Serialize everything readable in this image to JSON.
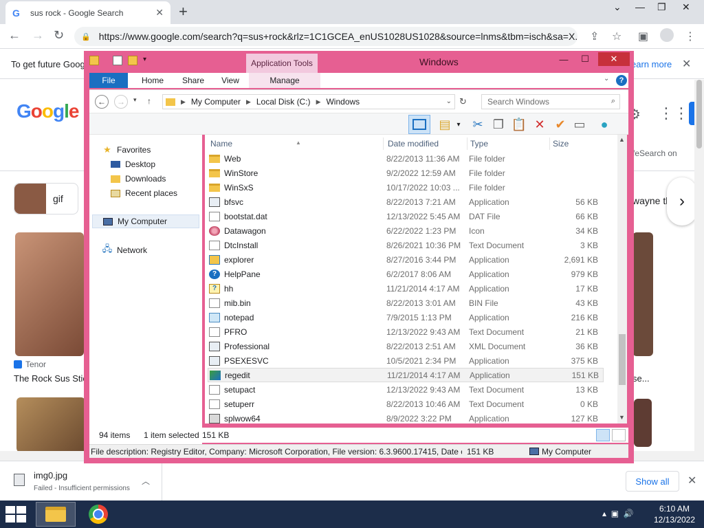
{
  "browser": {
    "tab_title": "sus rock - Google Search",
    "url": "https://www.google.com/search?q=sus+rock&rlz=1C1GCEA_enUS1028US1028&source=lnms&tbm=isch&sa=X...",
    "infobar_text": "To get future Goog",
    "infobar_link": "earn more"
  },
  "google": {
    "logo_letters": [
      "G",
      "o",
      "o",
      "g",
      "l",
      "e"
    ],
    "chip_label": "gif",
    "source_name": "Tenor",
    "result_title": "The Rock Sus Stick",
    "right_text_safesearch": "feSearch on",
    "right_text_chip": "wayne th",
    "right_text_result": "se..."
  },
  "downloads": {
    "file_name": "img0.jpg",
    "status": "Failed - Insufficient permissions",
    "show_all": "Show all"
  },
  "taskbar": {
    "time": "6:10 AM",
    "date": "12/13/2022"
  },
  "explorer": {
    "title": "Windows",
    "app_tools": "Application Tools",
    "tabs": {
      "file": "File",
      "home": "Home",
      "share": "Share",
      "view": "View",
      "manage": "Manage"
    },
    "breadcrumb": [
      "My Computer",
      "Local Disk (C:)",
      "Windows"
    ],
    "search_placeholder": "Search Windows",
    "nav": {
      "favorites": "Favorites",
      "desktop": "Desktop",
      "downloads": "Downloads",
      "recent": "Recent places",
      "my_computer": "My Computer",
      "network": "Network"
    },
    "columns": {
      "name": "Name",
      "date": "Date modified",
      "type": "Type",
      "size": "Size"
    },
    "files": [
      {
        "name": "Web",
        "date": "8/22/2013 11:36 AM",
        "type": "File folder",
        "size": "",
        "icon": "folder"
      },
      {
        "name": "WinStore",
        "date": "9/2/2022 12:59 AM",
        "type": "File folder",
        "size": "",
        "icon": "folder"
      },
      {
        "name": "WinSxS",
        "date": "10/17/2022 10:03 ...",
        "type": "File folder",
        "size": "",
        "icon": "folder"
      },
      {
        "name": "bfsvc",
        "date": "8/22/2013 7:21 AM",
        "type": "Application",
        "size": "56 KB",
        "icon": "app"
      },
      {
        "name": "bootstat.dat",
        "date": "12/13/2022 5:45 AM",
        "type": "DAT File",
        "size": "66 KB",
        "icon": "doc"
      },
      {
        "name": "Datawagon",
        "date": "6/22/2022 1:23 PM",
        "type": "Icon",
        "size": "34 KB",
        "icon": "icon"
      },
      {
        "name": "DtcInstall",
        "date": "8/26/2021 10:36 PM",
        "type": "Text Document",
        "size": "3 KB",
        "icon": "doc"
      },
      {
        "name": "explorer",
        "date": "8/27/2016 3:44 PM",
        "type": "Application",
        "size": "2,691 KB",
        "icon": "explorer"
      },
      {
        "name": "HelpPane",
        "date": "6/2/2017 8:06 AM",
        "type": "Application",
        "size": "979 KB",
        "icon": "help"
      },
      {
        "name": "hh",
        "date": "11/21/2014 4:17 AM",
        "type": "Application",
        "size": "17 KB",
        "icon": "hh"
      },
      {
        "name": "mib.bin",
        "date": "8/22/2013 3:01 AM",
        "type": "BIN File",
        "size": "43 KB",
        "icon": "doc"
      },
      {
        "name": "notepad",
        "date": "7/9/2015 1:13 PM",
        "type": "Application",
        "size": "216 KB",
        "icon": "notepad"
      },
      {
        "name": "PFRO",
        "date": "12/13/2022 9:43 AM",
        "type": "Text Document",
        "size": "21 KB",
        "icon": "doc"
      },
      {
        "name": "Professional",
        "date": "8/22/2013 2:51 AM",
        "type": "XML Document",
        "size": "36 KB",
        "icon": "app"
      },
      {
        "name": "PSEXESVC",
        "date": "10/5/2021 2:34 PM",
        "type": "Application",
        "size": "375 KB",
        "icon": "app"
      },
      {
        "name": "regedit",
        "date": "11/21/2014 4:17 AM",
        "type": "Application",
        "size": "151 KB",
        "icon": "regedit",
        "selected": true
      },
      {
        "name": "setupact",
        "date": "12/13/2022 9:43 AM",
        "type": "Text Document",
        "size": "13 KB",
        "icon": "doc"
      },
      {
        "name": "setuperr",
        "date": "8/22/2013 10:46 AM",
        "type": "Text Document",
        "size": "0 KB",
        "icon": "doc"
      },
      {
        "name": "splwow64",
        "date": "8/9/2022 3:22 PM",
        "type": "Application",
        "size": "127 KB",
        "icon": "print"
      }
    ],
    "status": {
      "items": "94 items",
      "selected": "1 item selected",
      "selected_size": "151 KB"
    },
    "description": "File description: Registry Editor, Company: Microsoft Corporation, File version: 6.3.9600.17415, Date crea",
    "desc_size": "151 KB",
    "desc_location": "My Computer"
  }
}
